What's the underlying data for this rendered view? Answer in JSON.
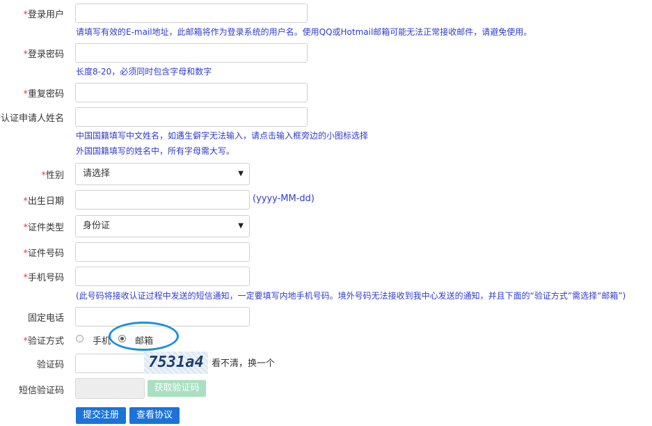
{
  "form": {
    "username": {
      "label": "登录用户",
      "value": "",
      "hint": "请填写有效的E-mail地址，此邮箱将作为登录系统的用户名。使用QQ或Hotmail邮箱可能无法正常接收邮件，请避免使用。"
    },
    "password": {
      "label": "登录密码",
      "value": "",
      "hint": "长度8-20，必须同时包含字母和数字"
    },
    "password_confirm": {
      "label": "重复密码",
      "value": ""
    },
    "applicant_name": {
      "label": "认证申请人姓名",
      "value": "",
      "hint_1": "中国国籍填写中文姓名，如遇生僻字无法输入，请点击输入框旁边的小图标选择",
      "hint_2": "外国国籍填写的姓名中，所有字母需大写。"
    },
    "gender": {
      "label": "性别",
      "selected": "请选择"
    },
    "birthdate": {
      "label": "出生日期",
      "value": "",
      "format_hint": "(yyyy-MM-dd)"
    },
    "id_type": {
      "label": "证件类型",
      "selected": "身份证"
    },
    "id_number": {
      "label": "证件号码",
      "value": ""
    },
    "mobile": {
      "label": "手机号码",
      "value": "",
      "hint": "(此号码将接收认证过程中发送的短信通知，一定要填写内地手机号码。境外号码无法接收到我中心发送的通知，并且下面的“验证方式”需选择“邮箱”)"
    },
    "landline": {
      "label": "固定电话",
      "value": ""
    },
    "verify_method": {
      "label": "验证方式",
      "option_phone": "手机",
      "option_email": "邮箱",
      "selected": "邮箱"
    },
    "captcha": {
      "label": "验证码",
      "value": "",
      "image_text": "7531a4",
      "refresh_text": "看不清，换一个"
    },
    "sms_code": {
      "label": "短信验证码",
      "value": "",
      "button": "获取验证码"
    },
    "required_mark": "*"
  },
  "actions": {
    "submit": "提交注册",
    "agreement": "查看协议"
  },
  "colors": {
    "hint_blue": "#2f3bd0",
    "required_red": "#e4393c",
    "button_blue": "#1a73d9",
    "disabled_green": "#a8e0c1",
    "highlight": "#1b8fe0"
  }
}
